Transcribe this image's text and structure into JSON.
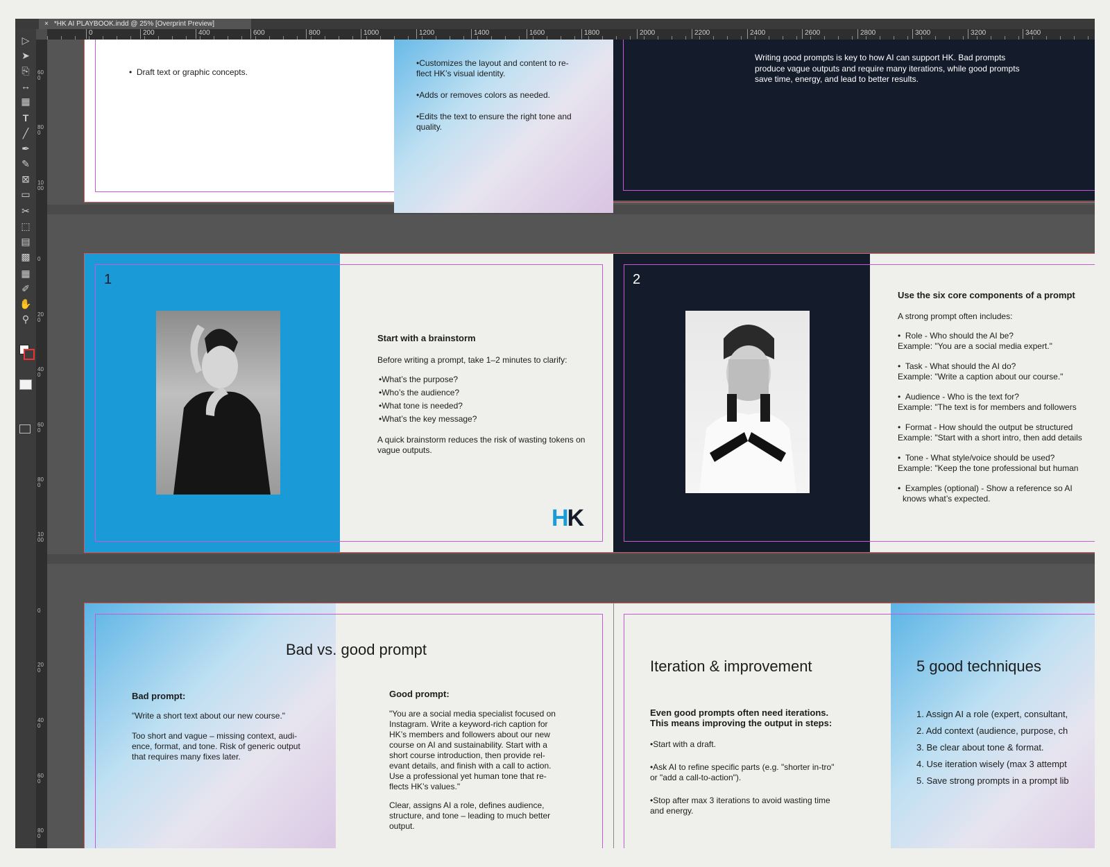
{
  "window": {
    "tab_title": "*HK AI PLAYBOOK.indd @ 25% [Overprint Preview]",
    "close_label": "×"
  },
  "tools": [
    "▷",
    "➤",
    "⎘",
    "↔",
    "▦",
    "T",
    "╱",
    "✒",
    "✎",
    "⊠",
    "▭",
    "✂",
    "⬚",
    "▤",
    "▩",
    "▦",
    "✐",
    "✋",
    "⚲"
  ],
  "ruler": {
    "h_ticks": [
      "0",
      "200",
      "400",
      "600",
      "800",
      "1000",
      "1200",
      "1400",
      "1600",
      "1800",
      "2000",
      "2200",
      "2400",
      "2600",
      "2800",
      "3000",
      "3200",
      "3400"
    ],
    "v_ticks_row1": [
      "600",
      "800",
      "1000"
    ],
    "v_ticks_row2": [
      "0",
      "200",
      "400",
      "600",
      "800",
      "1000"
    ],
    "v_ticks_row3": [
      "0",
      "200",
      "400",
      "600",
      "800"
    ]
  },
  "row1": {
    "left_bullet": "Draft text or graphic concepts.",
    "mid_bullets": [
      "Customizes the layout and content to re-flect HK’s visual identity.",
      "Adds or removes colors as needed.",
      "Edits the text to ensure the right tone and quality."
    ],
    "right_text": "produce vague outputs and require many iterations, while good prompts save time, energy, and lead to better results.",
    "right_text_top": "Writing good prompts is key to how AI can support HK. Bad prompts"
  },
  "row2": {
    "page1_number": "1",
    "brainstorm_title": "Start with a brainstorm",
    "brainstorm_intro": "Before writing a prompt, take 1–2 minutes to clarify:",
    "brainstorm_bullets": [
      "What’s the purpose?",
      "Who’s the audience?",
      "What tone is needed?",
      "What’s the key message?"
    ],
    "brainstorm_outro": "A quick brainstorm reduces the risk of wasting tokens on vague outputs.",
    "logo_h": "H",
    "logo_k": "K",
    "page2_number": "2",
    "components_title": "Use the six core components of a prompt",
    "components_intro": "A strong prompt often includes:",
    "components": [
      {
        "head": "Role - Who should the AI be?",
        "example": "Example: \"You are a social media expert.\""
      },
      {
        "head": "Task - What should the AI do?",
        "example": "Example: \"Write a caption about our course.\""
      },
      {
        "head": "Audience - Who is the text for?",
        "example": "Example: \"The text is for members and followers"
      },
      {
        "head": "Format - How should the output be structured",
        "example": "Example: \"Start with a short intro, then add details"
      },
      {
        "head": "Tone - What style/voice should be used?",
        "example": "Example: \"Keep the tone professional but human"
      },
      {
        "head": "Examples (optional) - Show a reference so AI",
        "example": "knows what’s expected."
      }
    ]
  },
  "row3": {
    "bad_good_title": "Bad vs. good prompt",
    "bad_label": "Bad prompt:",
    "bad_quote": "\"Write a short text about our new course.\"",
    "bad_comment": "Too short and vague – missing context, audi-ence, format, and tone. Risk of generic output that requires many fixes later.",
    "good_label": "Good prompt:",
    "good_quote": "\"You are a social media specialist focused on Instagram. Write a keyword-rich caption for HK’s members and followers about our new course on AI and sustainability. Start with a short course introduction, then provide rel-evant details, and finish with a call to action. Use a professional yet human tone that re-flects HK’s values.\"",
    "good_comment": "Clear, assigns AI a role, defines audience, structure, and tone – leading to much better output.",
    "iteration_title": "Iteration & improvement",
    "iteration_intro": "Even good prompts often need iterations. This means improving the output in steps:",
    "iteration_bullets": [
      "Start with a draft.",
      "Ask AI to refine specific parts (e.g. \"shorter in-tro\" or \"add a call-to-action\").",
      "Stop after max 3 iterations to avoid wasting time and energy."
    ],
    "techniques_title": "5 good techniques",
    "techniques": [
      "1. Assign AI a role (expert, consultant,",
      "2. Add context (audience, purpose, ch",
      "3. Be clear about tone & format.",
      "4. Use iteration wisely (max 3 attempt",
      "5. Save strong prompts in a prompt lib"
    ]
  },
  "colors": {
    "blue": "#1b9ad8",
    "navy": "#141c2b",
    "offwhite": "#efefeb",
    "margin": "#c858d8",
    "bleed": "#d06060"
  }
}
